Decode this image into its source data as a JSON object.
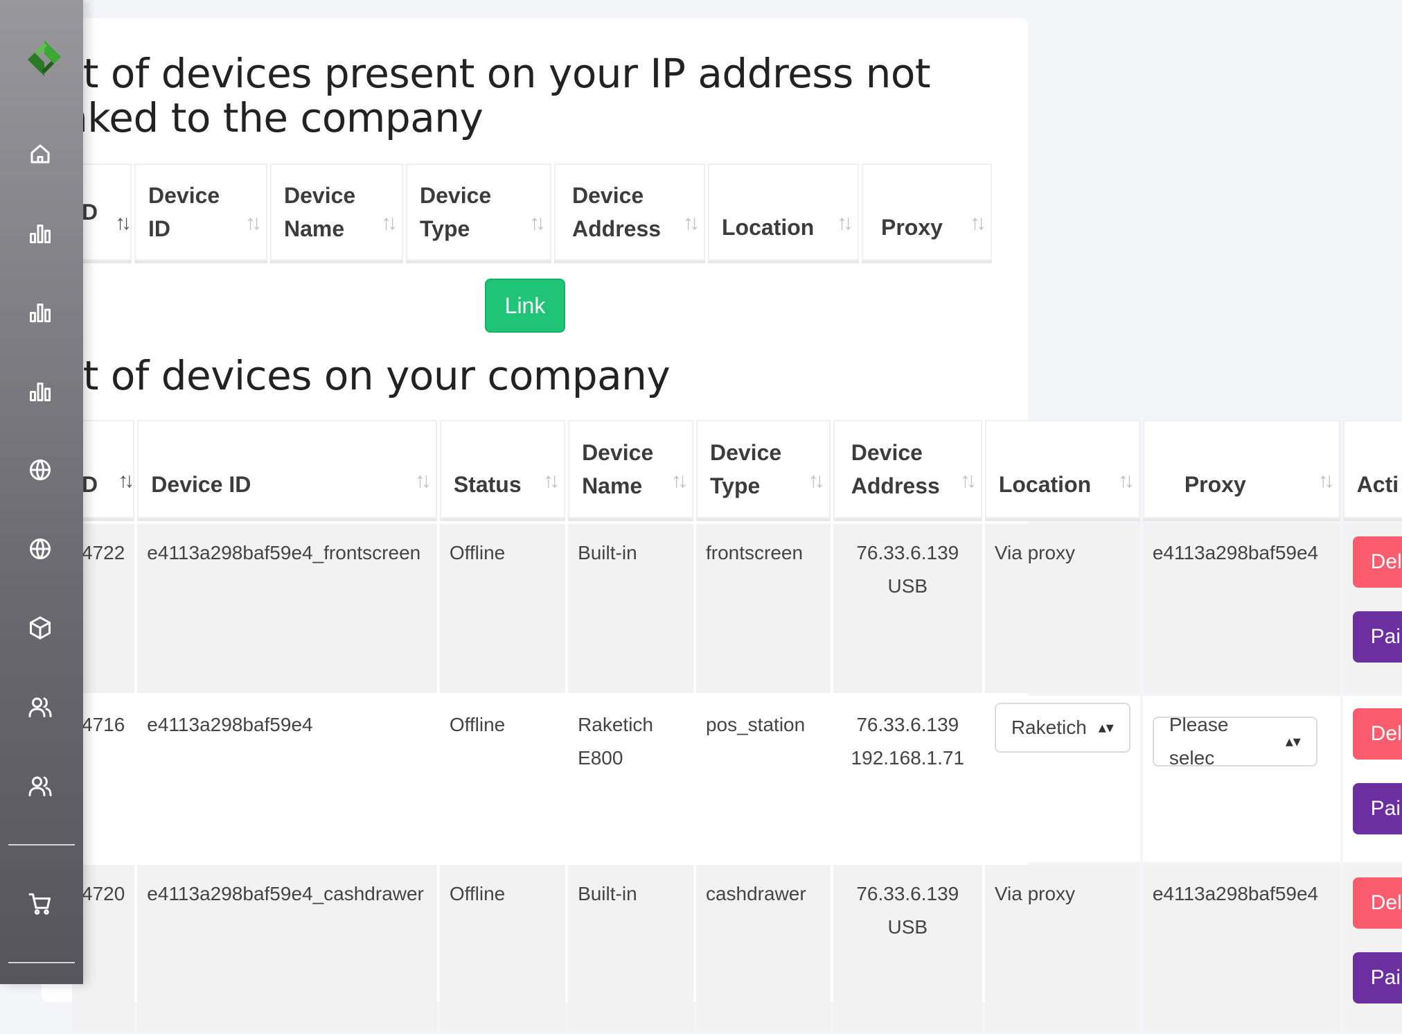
{
  "sidebar": {
    "logo": "app-logo",
    "items": [
      {
        "icon": "home-icon"
      },
      {
        "icon": "bar-chart-icon"
      },
      {
        "icon": "bar-chart-icon"
      },
      {
        "icon": "bar-chart-icon"
      },
      {
        "icon": "globe-icon"
      },
      {
        "icon": "globe-icon"
      },
      {
        "icon": "box-icon"
      },
      {
        "icon": "users-icon"
      },
      {
        "icon": "users-icon"
      },
      {
        "icon": "cart-icon"
      }
    ]
  },
  "section1": {
    "title_line1": "st of devices present on your IP address not",
    "title_line2": "nked to the company",
    "headers": [
      "D",
      "Device ID",
      "Device Name",
      "Device Type",
      "Device Address",
      "Location",
      "Proxy"
    ],
    "link_button": "Link"
  },
  "section2": {
    "title": "st of devices on your company",
    "headers": [
      "D",
      "Device ID",
      "Status",
      "Device Name",
      "Device Type",
      "Device Address",
      "Location",
      "Proxy",
      "Acti"
    ],
    "rows": [
      {
        "id": "4722",
        "device_id": "e4113a298baf59e4_frontscreen",
        "status": "Offline",
        "name": "Built-in",
        "type": "frontscreen",
        "address_1": "76.33.6.139",
        "address_2": "USB",
        "location": "Via proxy",
        "proxy": "e4113a298baf59e4",
        "delete": "Delete",
        "pair": "Pair"
      },
      {
        "id": "4716",
        "device_id": "e4113a298baf59e4",
        "status": "Offline",
        "name": "Raketich E800",
        "type": "pos_station",
        "address_1": "76.33.6.139",
        "address_2": "192.168.1.71",
        "location_select": "Raketich",
        "proxy_select": "Please selec",
        "delete": "Delete",
        "pair": "Pair"
      },
      {
        "id": "4720",
        "device_id": "e4113a298baf59e4_cashdrawer",
        "status": "Offline",
        "name": "Built-in",
        "type": "cashdrawer",
        "address_1": "76.33.6.139",
        "address_2": "USB",
        "location": "Via proxy",
        "proxy": "e4113a298baf59e4",
        "delete": "Delete",
        "pair": "Pair"
      }
    ]
  },
  "colors": {
    "link_green": "#1fc477",
    "delete_red": "#fb5d6f",
    "pair_purple": "#6b2fa0",
    "sidebar_gray": "#7a797f"
  }
}
